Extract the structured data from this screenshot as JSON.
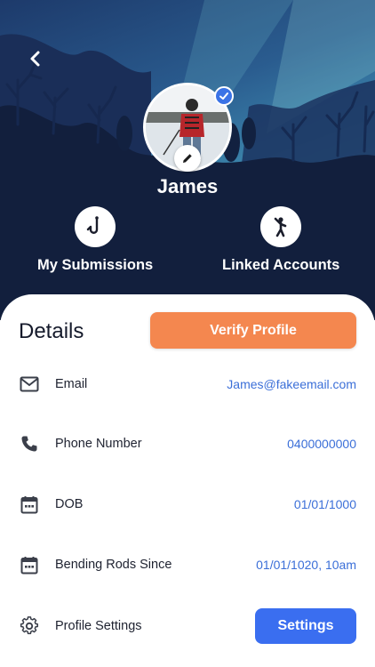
{
  "profile": {
    "name": "James",
    "verified": true
  },
  "quick_actions": [
    {
      "label": "My Submissions",
      "icon": "fishing-hook-icon"
    },
    {
      "label": "Linked Accounts",
      "icon": "person-cheering-icon"
    }
  ],
  "details": {
    "title": "Details",
    "verify_label": "Verify Profile",
    "rows": [
      {
        "label": "Email",
        "value": "James@fakeemail.com",
        "icon": "mail-icon"
      },
      {
        "label": "Phone Number",
        "value": "0400000000",
        "icon": "phone-icon"
      },
      {
        "label": "DOB",
        "value": "01/01/1000",
        "icon": "calendar-icon"
      },
      {
        "label": "Bending Rods Since",
        "value": "01/01/1020, 10am",
        "icon": "calendar-icon"
      },
      {
        "label": "Profile Settings",
        "icon": "gear-icon"
      }
    ],
    "settings_label": "Settings"
  },
  "colors": {
    "verify_button": "#f4874f",
    "settings_button": "#3a6ef0",
    "value_text": "#3b6fd8",
    "hero_dark": "#162744"
  }
}
